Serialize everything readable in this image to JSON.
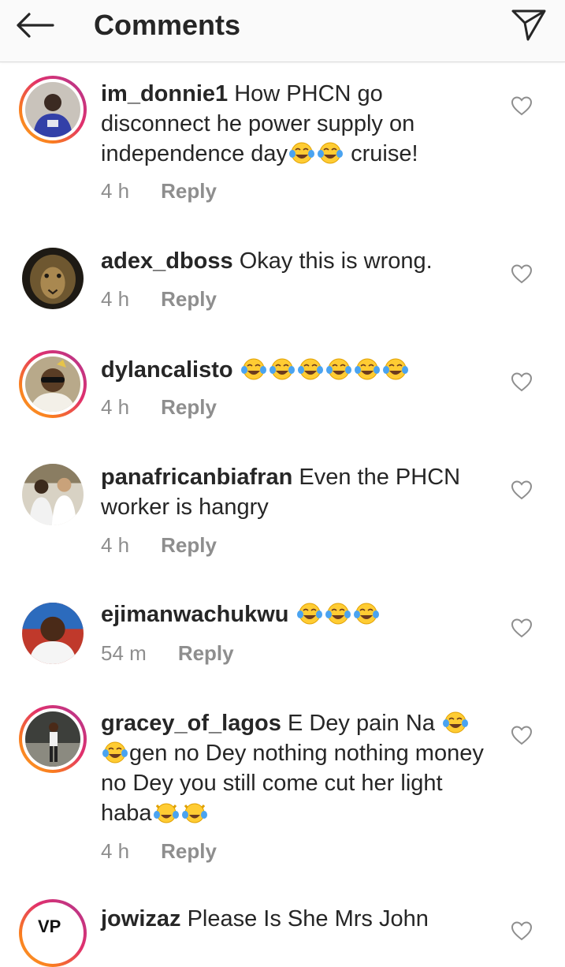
{
  "header": {
    "title": "Comments",
    "back_icon": "arrow-left-icon",
    "share_icon": "paper-plane-icon"
  },
  "reply_label": "Reply",
  "colors": {
    "text": "#262626",
    "meta": "#8e8e8e",
    "story_ring": "#e1306c",
    "header_bg": "#fafafa"
  },
  "comments": [
    {
      "username": "im_donnie1",
      "text_parts": [
        " How PHCN go disconnect he power supply on independence day",
        "😂😂",
        " cruise!"
      ],
      "time": "4 h",
      "story_ring": true
    },
    {
      "username": "adex_dboss",
      "text_parts": [
        " Okay this is wrong."
      ],
      "time": "4 h",
      "story_ring": false
    },
    {
      "username": "dylancalisto",
      "text_parts": [
        " ",
        "😂😂😂😂😂😂"
      ],
      "time": "4 h",
      "story_ring": true
    },
    {
      "username": "panafricanbiafran",
      "text_parts": [
        " Even the PHCN worker is hangry"
      ],
      "time": "4 h",
      "story_ring": false
    },
    {
      "username": "ejimanwachukwu",
      "text_parts": [
        " ",
        "😂😂😂"
      ],
      "time": "54 m",
      "story_ring": false
    },
    {
      "username": "gracey_of_lagos",
      "text_parts": [
        " E Dey pain Na ",
        "😂😂",
        "gen no Dey nothing nothing money no Dey you still come cut her light haba",
        "😹😹"
      ],
      "time": "4 h",
      "story_ring": true
    },
    {
      "username": "jowizaz",
      "text_parts": [
        " Please Is She Mrs John"
      ],
      "time": "",
      "story_ring": true
    }
  ]
}
